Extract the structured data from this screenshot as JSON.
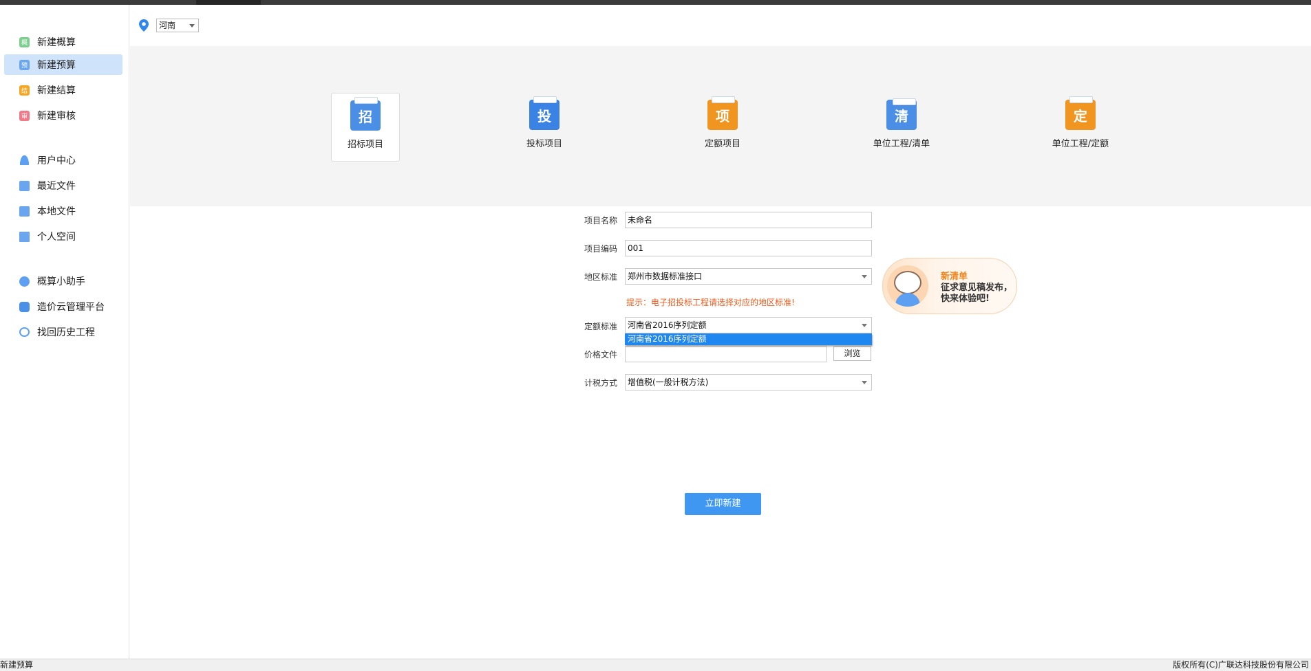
{
  "sidebar": {
    "items": [
      {
        "label": "新建概算",
        "icon": "estimate-icon",
        "glyph": "概"
      },
      {
        "label": "新建预算",
        "icon": "budget-icon",
        "glyph": "预"
      },
      {
        "label": "新建结算",
        "icon": "settlement-icon",
        "glyph": "结"
      },
      {
        "label": "新建审核",
        "icon": "audit-icon",
        "glyph": "审"
      },
      {
        "label": "用户中心",
        "icon": "user-icon"
      },
      {
        "label": "最近文件",
        "icon": "recent-files-icon"
      },
      {
        "label": "本地文件",
        "icon": "local-files-icon"
      },
      {
        "label": "个人空间",
        "icon": "personal-space-icon"
      },
      {
        "label": "概算小助手",
        "icon": "assistant-icon"
      },
      {
        "label": "造价云管理平台",
        "icon": "cloud-platform-icon"
      },
      {
        "label": "找回历史工程",
        "icon": "history-icon"
      }
    ],
    "active_index": 1
  },
  "region": {
    "selected": "河南"
  },
  "project_types": [
    {
      "label": "招标项目",
      "glyph": "招",
      "color": "#4a8ee6"
    },
    {
      "label": "投标项目",
      "glyph": "投",
      "color": "#3a82e3"
    },
    {
      "label": "定额项目",
      "glyph": "项",
      "color": "#f0951f"
    },
    {
      "label": "单位工程/清单",
      "glyph": "清",
      "color": "#4a8ee6"
    },
    {
      "label": "单位工程/定额",
      "glyph": "定",
      "color": "#f0951f"
    }
  ],
  "form": {
    "project_name_label": "项目名称",
    "project_name_value": "未命名",
    "project_code_label": "项目编码",
    "project_code_value": "001",
    "region_standard_label": "地区标准",
    "region_standard_value": "郑州市数据标准接口",
    "hint": "提示：电子招投标工程请选择对应的地区标准!",
    "quota_standard_label": "定额标准",
    "quota_standard_value": "河南省2016序列定额",
    "quota_dropdown_option": "河南省2016序列定额",
    "price_file_label": "价格文件",
    "price_file_value": "",
    "browse_label": "浏览",
    "tax_method_label": "计税方式",
    "tax_method_value": "增值税(一般计税方法)",
    "submit_label": "立即新建"
  },
  "promo": {
    "title": "新清单",
    "text": "征求意见稿发布，快来体验吧!"
  },
  "status": {
    "left": "新建预算",
    "right": "版权所有(C)广联达科技股份有限公司"
  }
}
